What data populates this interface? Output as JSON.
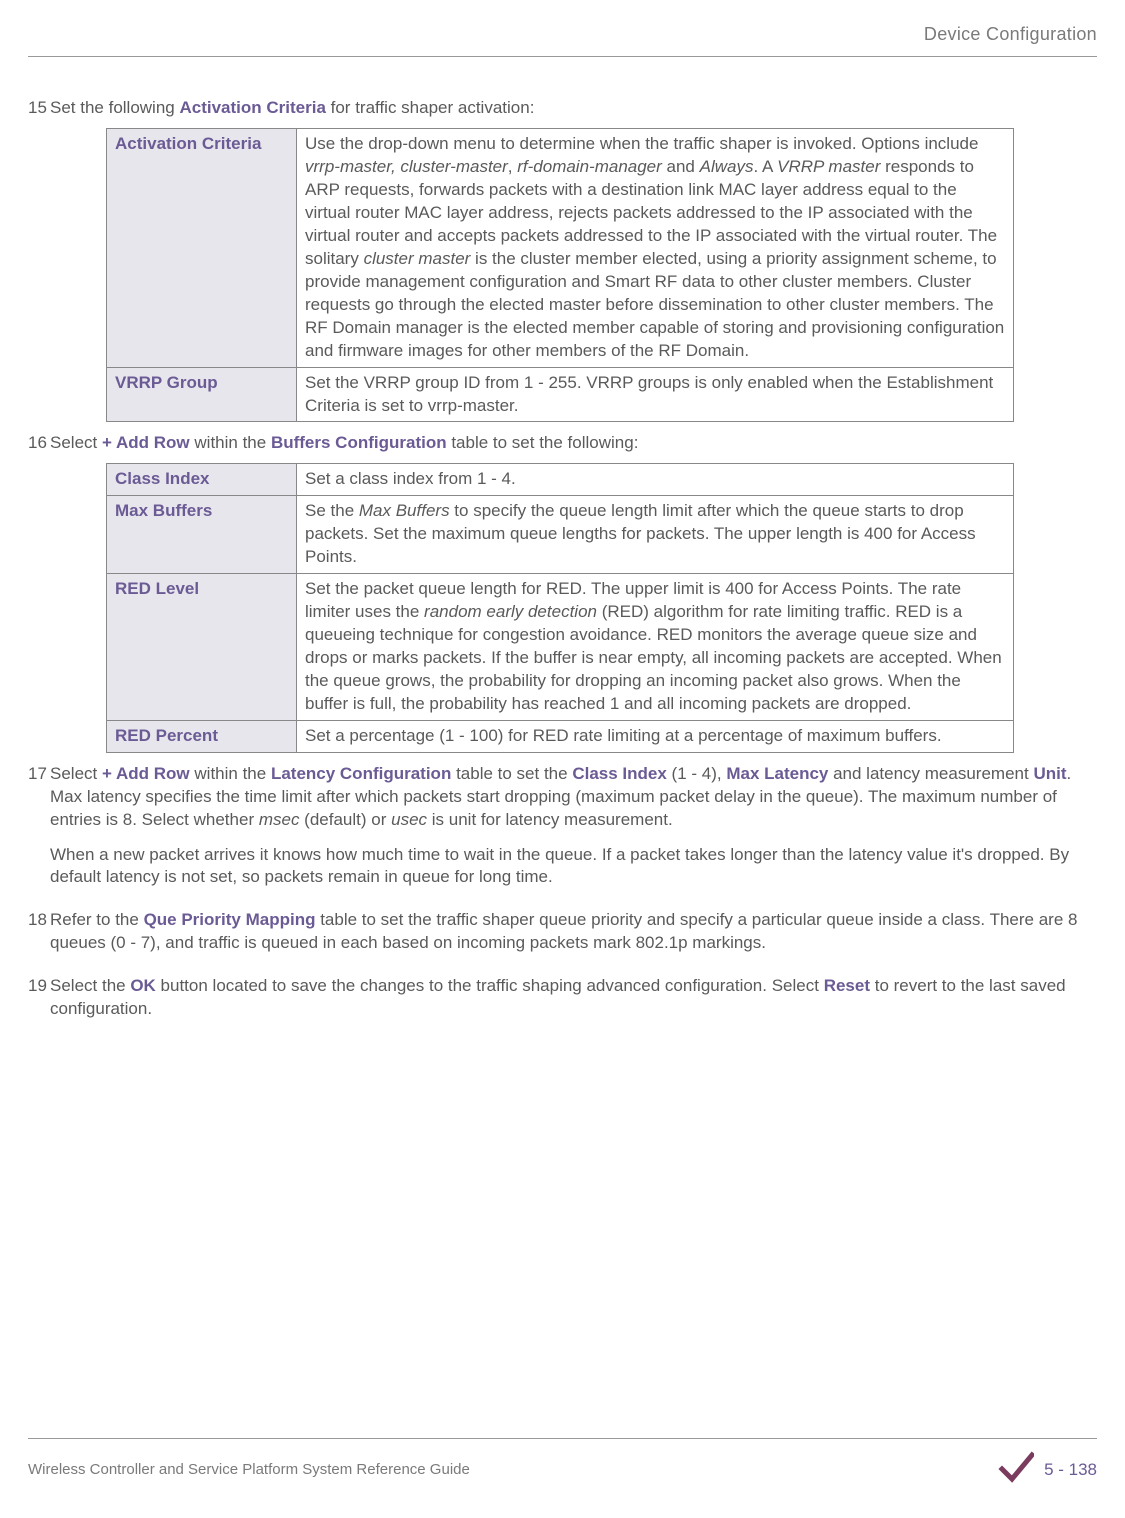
{
  "header": {
    "title": "Device Configuration"
  },
  "steps": {
    "s15": {
      "num": "15",
      "text_before": "Set the following ",
      "bold1": "Activation Criteria",
      "text_after": " for traffic shaper activation:"
    },
    "s16": {
      "num": "16",
      "text_before": "Select ",
      "bold1": "+ Add Row",
      "text_mid1": " within the ",
      "bold2": "Buffers Configuration",
      "text_after": " table to set the following:"
    },
    "s17": {
      "num": "17",
      "t1": "Select ",
      "b1": "+ Add Row",
      "t2": " within the ",
      "b2": "Latency Configuration",
      "t3": " table to set the ",
      "b3": "Class Index",
      "t4": " (1 - 4), ",
      "b4": "Max Latency",
      "t5": " and latency measurement ",
      "b5": "Unit",
      "t6": ". Max latency specifies the time limit after which packets start dropping (maximum packet delay in the queue). The maximum number of entries is 8. Select whether ",
      "i1": "msec",
      "t7": " (default) or ",
      "i2": "usec",
      "t8": " is unit for latency measurement.",
      "para2": "When a new packet arrives it knows how much time to wait in the queue. If a packet takes longer than the latency value it's dropped. By default latency is not set, so packets remain in queue for long time."
    },
    "s18": {
      "num": "18",
      "t1": "Refer to the ",
      "b1": "Que Priority Mapping",
      "t2": " table to set the traffic shaper queue priority and specify a particular queue inside a class. There are 8 queues (0 - 7), and traffic is queued in each based on incoming packets mark 802.1p markings."
    },
    "s19": {
      "num": "19",
      "t1": "Select the ",
      "b1": "OK",
      "t2": " button located to save the changes to the traffic shaping advanced configuration. Select ",
      "b2": "Reset",
      "t3": " to revert to the last saved configuration."
    }
  },
  "table1": {
    "r1": {
      "label": "Activation Criteria",
      "d_t1": "Use the drop-down menu to determine when the traffic shaper is invoked. Options include ",
      "d_i1": "vrrp-master, cluster-master",
      "d_t2": ", ",
      "d_i2": "rf-domain-manager",
      "d_t3": " and ",
      "d_i3": "Always",
      "d_t4": ". A ",
      "d_i4": "VRRP master",
      "d_t5": " responds to ARP requests, forwards packets with a destination link MAC layer address equal to the virtual router MAC layer address, rejects packets addressed to the IP associated with the virtual router and accepts packets addressed to the IP associated with the virtual router. The solitary ",
      "d_i5": "cluster master",
      "d_t6": " is the cluster member elected, using a priority assignment scheme, to provide management configuration and Smart RF data to other cluster members. Cluster requests go through the elected master before dissemination to other cluster members. The RF Domain manager is the elected member capable of storing and provisioning configuration and firmware images for other members of the RF Domain."
    },
    "r2": {
      "label": "VRRP Group",
      "desc": "Set the VRRP group ID from 1 - 255. VRRP groups is only enabled when the Establishment Criteria is set to vrrp-master."
    }
  },
  "table2": {
    "r1": {
      "label": "Class Index",
      "desc": "Set a class index from 1 - 4."
    },
    "r2": {
      "label": "Max Buffers",
      "d_t1": "Se the ",
      "d_i1": "Max Buffers",
      "d_t2": " to specify the queue length limit after which the queue starts to drop packets. Set the maximum queue lengths for packets. The upper length is 400 for Access Points."
    },
    "r3": {
      "label": "RED Level",
      "d_t1": "Set the packet queue length for RED. The upper limit is 400 for Access Points. The rate limiter uses the ",
      "d_i1": "random early detection",
      "d_t2": " (RED) algorithm for rate limiting traffic. RED is a queueing technique for congestion avoidance. RED monitors the average queue size and drops or marks packets. If the buffer is near empty, all incoming packets are accepted. When the queue grows, the probability for dropping an incoming packet also grows. When the buffer is full, the probability has reached 1 and all incoming packets are dropped."
    },
    "r4": {
      "label": "RED Percent",
      "desc": "Set a percentage (1 - 100) for RED rate limiting at a percentage of maximum buffers."
    }
  },
  "footer": {
    "left": "Wireless Controller and Service Platform System Reference Guide",
    "page": "5 - 138"
  }
}
